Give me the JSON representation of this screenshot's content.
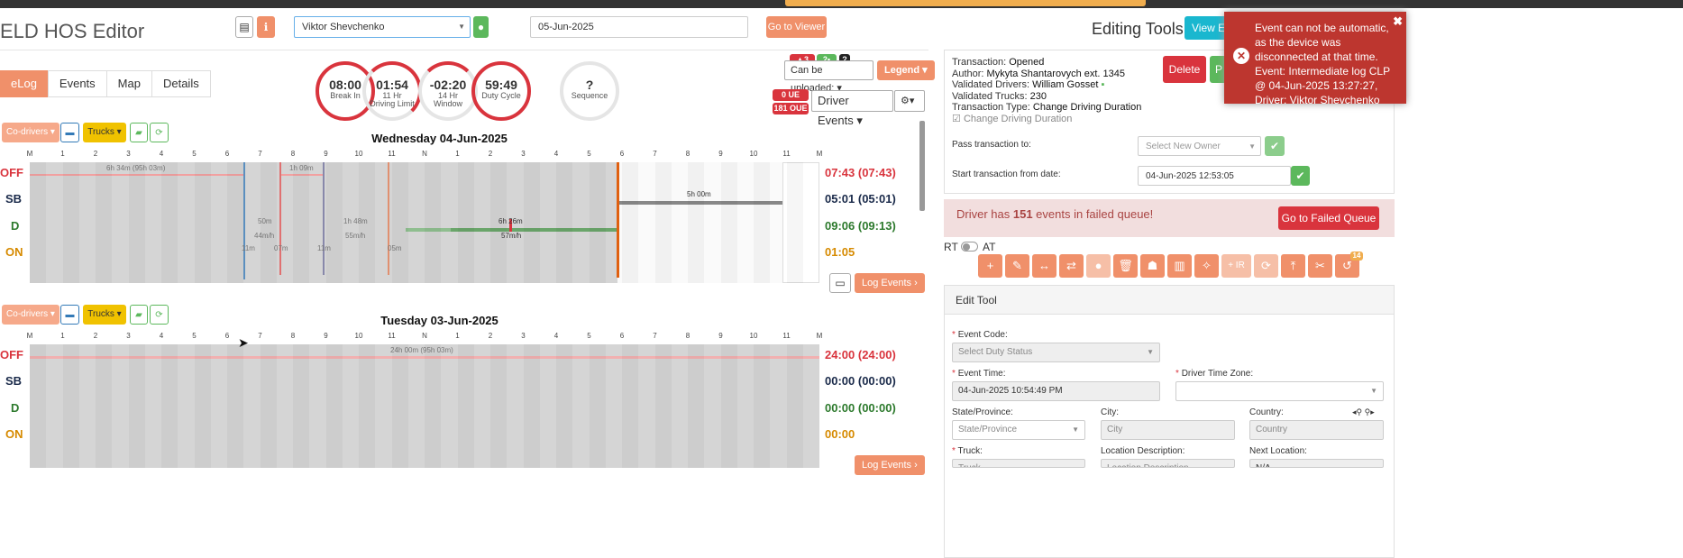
{
  "app": {
    "title": "ELD HOS Editor"
  },
  "header": {
    "driver_select": "Viktor Shevchenko",
    "date_value": "05-Jun-2025",
    "go_to_viewer": "Go to Viewer",
    "editing_tools": "Editing Tools",
    "view_button": "View E"
  },
  "tabs": [
    {
      "label": "eLog"
    },
    {
      "label": "Events"
    },
    {
      "label": "Map"
    },
    {
      "label": "Details"
    }
  ],
  "gauges": [
    {
      "value": "08:00",
      "l1": "Break In",
      "l2": ""
    },
    {
      "value": "01:54",
      "l1": "11 Hr",
      "l2": "Driving Limit"
    },
    {
      "value": "-02:20",
      "l1": "14 Hr",
      "l2": "Window"
    },
    {
      "value": "59:49",
      "l1": "Duty Cycle",
      "l2": ""
    },
    {
      "value": "?",
      "l1": "Sequence",
      "l2": ""
    }
  ],
  "badges": {
    "a": "3",
    "b": "2",
    "c": "?",
    "ue": "0 UE",
    "oue": "181 OUE"
  },
  "controls": {
    "can_be_uploaded": "Can be uploaded:",
    "legend": "Legend",
    "driver_events": "Driver Events",
    "co_drivers": "Co-drivers",
    "trucks": "Trucks",
    "log_events": "Log Events"
  },
  "hours": [
    "M",
    "1",
    "2",
    "3",
    "4",
    "5",
    "6",
    "7",
    "8",
    "9",
    "10",
    "11",
    "N",
    "1",
    "2",
    "3",
    "4",
    "5",
    "6",
    "7",
    "8",
    "9",
    "10",
    "11",
    "M"
  ],
  "status_labels": [
    "OFF",
    "SB",
    "D",
    "ON"
  ],
  "days": [
    {
      "title": "Wednesday 04-Jun-2025",
      "totals": [
        "07:43 (07:43)",
        "05:01 (05:01)",
        "09:06 (09:13)",
        "01:05"
      ],
      "annotations": [
        "6h 34m (95h 03m)",
        "1h 09m",
        "5h 00m",
        "50m",
        "44m/h",
        "1h 48m",
        "55m/h",
        "6h 26m",
        "57m/h",
        "11m",
        "07m",
        "11m",
        "05m"
      ]
    },
    {
      "title": "Tuesday 03-Jun-2025",
      "totals": [
        "24:00 (24:00)",
        "00:00 (00:00)",
        "00:00 (00:00)",
        "00:00"
      ],
      "annotations": [
        "24h 00m (95h 03m)"
      ]
    }
  ],
  "transaction": {
    "status_label": "Transaction:",
    "status": "Opened",
    "author_label": "Author:",
    "author": "Mykyta Shantarovych ext. 1345",
    "drivers_label": "Validated Drivers:",
    "drivers": "William Gosset",
    "trucks_label": "Validated Trucks:",
    "trucks": "230",
    "type_label": "Transaction Type:",
    "type": "Change Driving Duration",
    "checkbox_label": "Change Driving Duration",
    "delete": "Delete",
    "p_button": "P",
    "pass_label": "Pass transaction to:",
    "pass_placeholder": "Select New Owner",
    "start_label": "Start transaction from date:",
    "start_value": "04-Jun-2025 12:53:05"
  },
  "failed": {
    "prefix": "Driver has ",
    "count": "151",
    "suffix": " events in failed queue!",
    "button": "Go to Failed Queue"
  },
  "rt": "RT",
  "at": "AT",
  "tool_badge": "14",
  "tool_ir": "+ IR",
  "edit_tool": {
    "header": "Edit Tool",
    "event_code_label": "Event Code:",
    "event_code_placeholder": "Select Duty Status",
    "event_time_label": "Event Time:",
    "event_time_value": "04-Jun-2025 10:54:49 PM",
    "tz_label": "Driver Time Zone:",
    "state_label": "State/Province:",
    "state_placeholder": "State/Province",
    "city_label": "City:",
    "city_placeholder": "City",
    "country_label": "Country:",
    "country_placeholder": "Country",
    "truck_label": "Truck:",
    "truck_placeholder": "Truck",
    "locdesc_label": "Location Description:",
    "locdesc_placeholder": "Location Description",
    "nextloc_label": "Next Location:",
    "nextloc_value": "N/A"
  },
  "toast": {
    "message": "Event can not be automatic, as the device was disconnected at that time. Event: Intermediate log CLP @ 04-Jun-2025 13:27:27, Driver: Viktor Shevchenko"
  },
  "colors": {
    "accent": "#f0906a",
    "danger": "#d9343d",
    "success": "#5cb85c",
    "warning": "#f0ad4e"
  }
}
